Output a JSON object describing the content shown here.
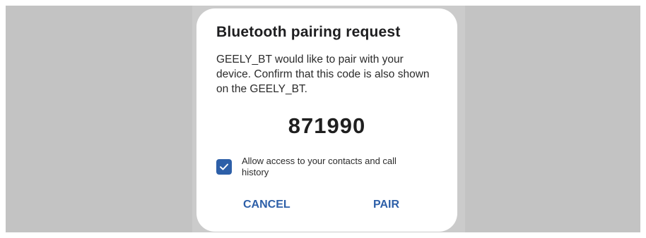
{
  "dialog": {
    "title": "Bluetooth pairing request",
    "message": "GEELY_BT would like to pair with your device. Confirm that this code is also shown on the GEELY_BT.",
    "code": "871990",
    "checkbox": {
      "checked": true,
      "label": "Allow access to your contacts and call history",
      "icon": "checkmark-icon",
      "color": "#2d5fa8"
    },
    "buttons": {
      "cancel": "CANCEL",
      "pair": "PAIR",
      "color": "#2d5fa8"
    }
  }
}
